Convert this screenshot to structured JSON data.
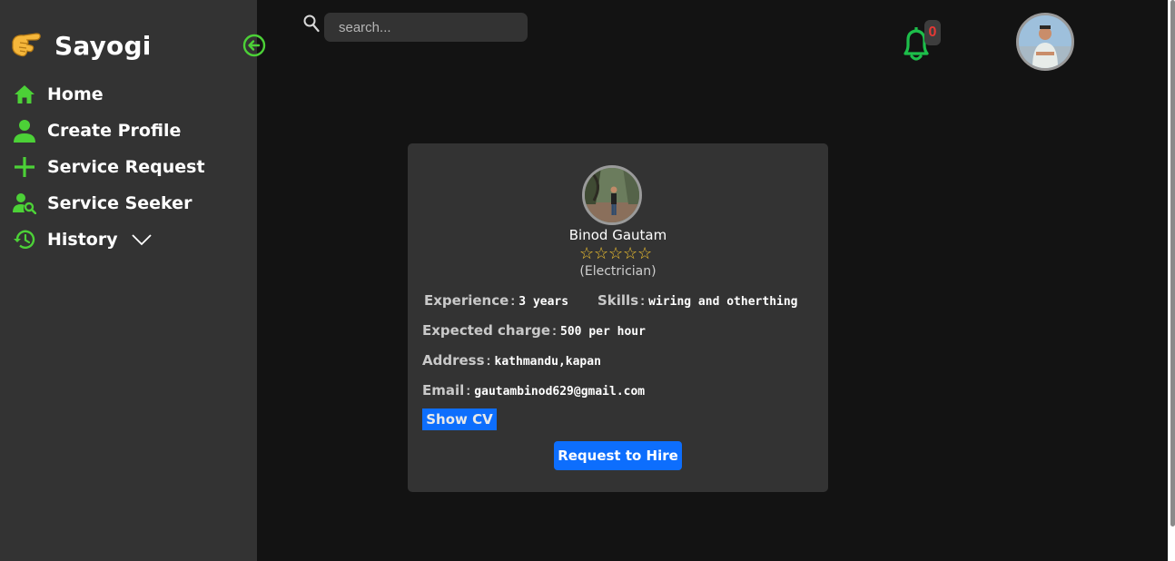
{
  "brand": {
    "name": "Sayogi",
    "icon": "pointing-hand-icon"
  },
  "sidebar": {
    "items": [
      {
        "label": "Home",
        "icon": "home-icon"
      },
      {
        "label": "Create Profile",
        "icon": "person-icon"
      },
      {
        "label": "Service Request",
        "icon": "plus-icon"
      },
      {
        "label": "Service Seeker",
        "icon": "person-search-icon"
      },
      {
        "label": "History",
        "icon": "history-icon",
        "dropdown_icon": "chevron-down-icon"
      }
    ],
    "collapse_icon": "arrow-left-circle-icon"
  },
  "header": {
    "search": {
      "placeholder": "search..."
    },
    "notifications": {
      "count": "0",
      "icon": "bell-icon"
    }
  },
  "profile": {
    "name": "Binod Gautam",
    "rating": {
      "value": 0,
      "max": 5
    },
    "profession": "(Electrician)",
    "fields": {
      "experience": {
        "label": "Experience",
        "sep": ":",
        "value": "3 years"
      },
      "skills": {
        "label": "Skills",
        "sep": ":",
        "value": "wiring and otherthing"
      },
      "charge": {
        "label": "Expected charge",
        "sep": ":",
        "value": "500 per hour"
      },
      "address": {
        "label": "Address",
        "sep": ":",
        "value": "kathmandu,kapan"
      },
      "email": {
        "label": "Email",
        "sep": ":",
        "value": "gautambinod629@gmail.com"
      }
    },
    "show_cv_label": "Show CV",
    "hire_label": "Request to Hire"
  },
  "colors": {
    "sidebar_bg": "#333333",
    "page_bg": "#131313",
    "accent_green": "#4cd137",
    "button_blue": "#0d6efd",
    "star_gold": "#f4c430",
    "badge_red": "#e53935"
  }
}
